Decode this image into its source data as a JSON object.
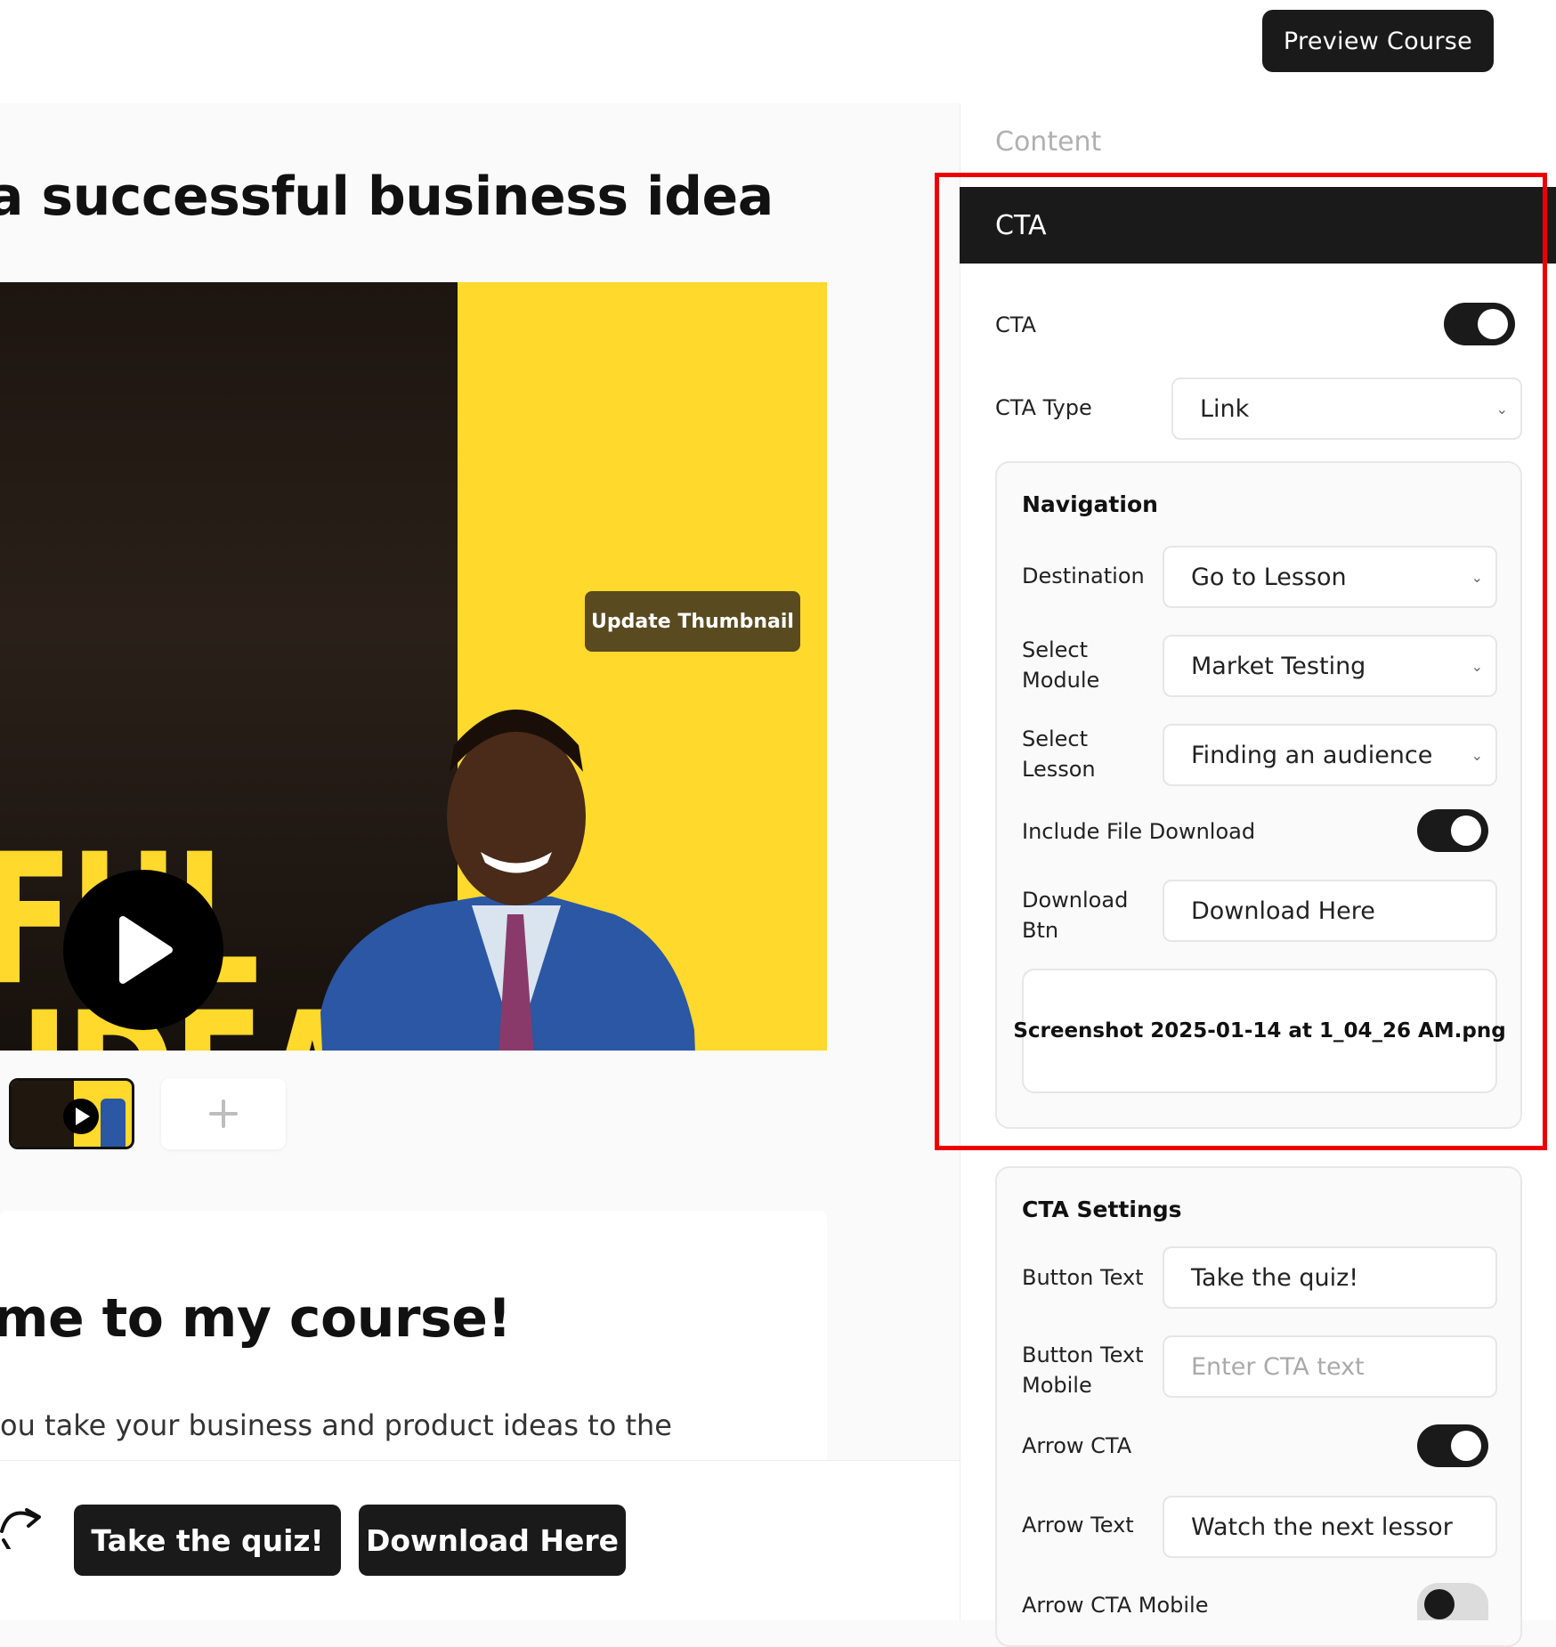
{
  "header": {
    "preview_button": "Preview Course"
  },
  "lesson": {
    "title": "a successful business idea",
    "thumbnail_button": "Update Thumbnail",
    "video_words": [
      "FUL",
      "IDEA"
    ],
    "welcome_heading": "me to my course!",
    "intro_text": "ou take your business and product ideas to the"
  },
  "bottom_bar": {
    "cta_primary": "Take the quiz!",
    "cta_secondary": "Download Here"
  },
  "panel": {
    "section_label": "Content",
    "cta_section": {
      "header": "CTA",
      "cta_label": "CTA",
      "cta_enabled": true,
      "cta_type_label": "CTA Type",
      "cta_type_value": "Link",
      "navigation": {
        "title": "Navigation",
        "destination_label": "Destination",
        "destination_value": "Go to Lesson",
        "module_label_1": "Select",
        "module_label_2": "Module",
        "module_value": "Market Testing",
        "lesson_label_1": "Select",
        "lesson_label_2": "Lesson",
        "lesson_value": "Finding an audience",
        "file_download_label": "Include File Download",
        "file_download_enabled": true,
        "download_btn_label_1": "Download",
        "download_btn_label_2": "Btn",
        "download_btn_value": "Download Here",
        "file_name": "Screenshot 2025-01-14 at 1_04_26 AM.png"
      }
    },
    "cta_settings": {
      "title": "CTA Settings",
      "button_text_label": "Button Text",
      "button_text_value": "Take the quiz!",
      "button_text_mobile_label_1": "Button Text",
      "button_text_mobile_label_2": "Mobile",
      "button_text_mobile_placeholder": "Enter CTA text",
      "arrow_cta_label": "Arrow CTA",
      "arrow_cta_enabled": true,
      "arrow_text_label": "Arrow Text",
      "arrow_text_value": "Watch the next lessor",
      "arrow_cta_mobile_label": "Arrow CTA Mobile",
      "arrow_cta_mobile_enabled": false
    }
  },
  "colors": {
    "dark": "#1a1a1a",
    "accent_yellow": "#FFD92B",
    "highlight_red": "#ee0000"
  }
}
